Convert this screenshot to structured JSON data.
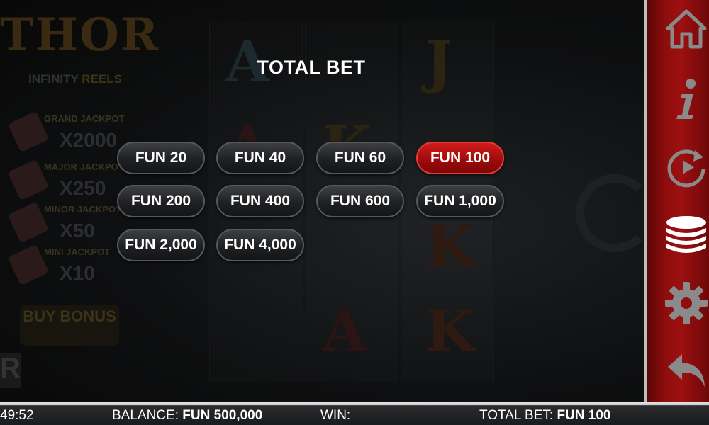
{
  "background": {
    "logo": "THOR",
    "subtitle": "INFINITY",
    "subtitle_reels": "REELS",
    "jackpots": [
      {
        "name": "GRAND JACKPOT",
        "multiplier": "X2000"
      },
      {
        "name": "MAJOR JACKPOT",
        "multiplier": "X250"
      },
      {
        "name": "MINOR JACKPOT",
        "multiplier": "X50"
      },
      {
        "name": "MINI JACKPOT",
        "multiplier": "X10"
      }
    ],
    "buy_bonus": "BUY BONUS",
    "reel_symbols": [
      "A",
      "J",
      "A",
      "K",
      "K",
      "A",
      "K"
    ]
  },
  "overlay": {
    "title": "TOTAL BET",
    "bets": [
      {
        "label": "FUN 20",
        "selected": false
      },
      {
        "label": "FUN 40",
        "selected": false
      },
      {
        "label": "FUN 60",
        "selected": false
      },
      {
        "label": "FUN 100",
        "selected": true
      },
      {
        "label": "FUN 200",
        "selected": false
      },
      {
        "label": "FUN 400",
        "selected": false
      },
      {
        "label": "FUN 600",
        "selected": false
      },
      {
        "label": "FUN 1,000",
        "selected": false
      },
      {
        "label": "FUN 2,000",
        "selected": false
      },
      {
        "label": "FUN 4,000",
        "selected": false
      }
    ]
  },
  "sidebar": {
    "buttons": [
      "home-icon",
      "info-icon",
      "autoplay-icon",
      "bet-chips-icon",
      "settings-icon",
      "back-icon"
    ],
    "active": "bet-chips-icon"
  },
  "status": {
    "time": "49:52",
    "balance_label": "BALANCE:",
    "balance_value": "FUN 500,000",
    "win_label": "WIN:",
    "win_value": "",
    "total_bet_label": "TOTAL BET:",
    "total_bet_value": "FUN 100"
  },
  "colors": {
    "selected_bet": "#b41212",
    "sidebar_red": "#8e0d0d",
    "icon_grey": "#8a8a8a",
    "icon_active": "#ffffff"
  }
}
